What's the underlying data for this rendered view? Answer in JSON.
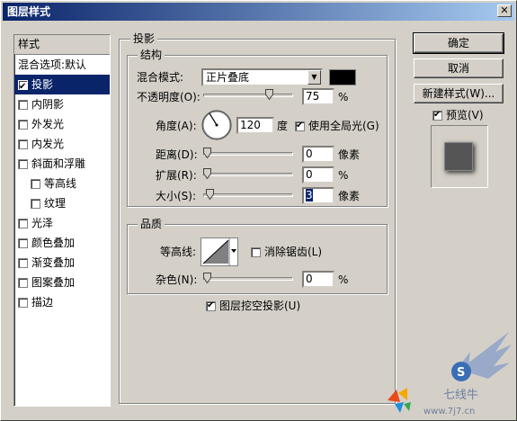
{
  "title": "图层样式",
  "close_glyph": "✕",
  "styles_panel": {
    "header": "样式",
    "items": [
      {
        "label": "混合选项:默认",
        "checkbox": false,
        "checked": false,
        "indent": false,
        "selected": false
      },
      {
        "label": "投影",
        "checkbox": true,
        "checked": true,
        "indent": false,
        "selected": true
      },
      {
        "label": "内阴影",
        "checkbox": true,
        "checked": false,
        "indent": false,
        "selected": false
      },
      {
        "label": "外发光",
        "checkbox": true,
        "checked": false,
        "indent": false,
        "selected": false
      },
      {
        "label": "内发光",
        "checkbox": true,
        "checked": false,
        "indent": false,
        "selected": false
      },
      {
        "label": "斜面和浮雕",
        "checkbox": true,
        "checked": false,
        "indent": false,
        "selected": false
      },
      {
        "label": "等高线",
        "checkbox": true,
        "checked": false,
        "indent": true,
        "selected": false
      },
      {
        "label": "纹理",
        "checkbox": true,
        "checked": false,
        "indent": true,
        "selected": false
      },
      {
        "label": "光泽",
        "checkbox": true,
        "checked": false,
        "indent": false,
        "selected": false
      },
      {
        "label": "颜色叠加",
        "checkbox": true,
        "checked": false,
        "indent": false,
        "selected": false
      },
      {
        "label": "渐变叠加",
        "checkbox": true,
        "checked": false,
        "indent": false,
        "selected": false
      },
      {
        "label": "图案叠加",
        "checkbox": true,
        "checked": false,
        "indent": false,
        "selected": false
      },
      {
        "label": "描边",
        "checkbox": true,
        "checked": false,
        "indent": false,
        "selected": false
      }
    ]
  },
  "drop_shadow": {
    "group_title": "投影",
    "structure": {
      "title": "结构",
      "blend_mode_label": "混合模式:",
      "blend_mode_value": "正片叠底",
      "blend_color": "#000000",
      "opacity_label": "不透明度(O):",
      "opacity_value": "75",
      "opacity_unit": "%",
      "opacity_level": 75,
      "angle_label": "角度(A):",
      "angle_value": "120",
      "angle_unit": "度",
      "use_global_light_label": "使用全局光(G)",
      "use_global_light_checked": true,
      "distance_label": "距离(D):",
      "distance_value": "0",
      "distance_unit": "像素",
      "spread_label": "扩展(R):",
      "spread_value": "0",
      "spread_unit": "%",
      "size_label": "大小(S):",
      "size_value": "3",
      "size_unit": "像素"
    },
    "quality": {
      "title": "品质",
      "contour_label": "等高线:",
      "anti_alias_label": "消除锯齿(L)",
      "anti_alias_checked": false,
      "noise_label": "杂色(N):",
      "noise_value": "0",
      "noise_unit": "%"
    },
    "knockout_label": "图层挖空投影(U)",
    "knockout_checked": true
  },
  "buttons": {
    "ok": "确定",
    "cancel": "取消",
    "new_style": "新建样式(W)...",
    "preview_label": "预览(V)",
    "preview_checked": true
  },
  "watermark": {
    "text": "七线牛",
    "url": "www.7j7.cn"
  }
}
